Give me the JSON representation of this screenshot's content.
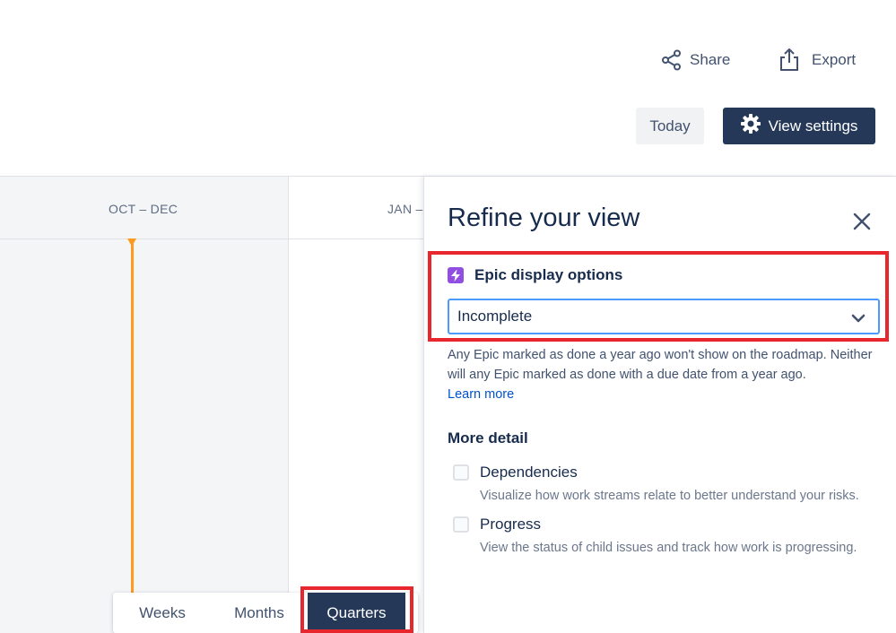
{
  "toolbar": {
    "share_label": "Share",
    "export_label": "Export",
    "today_label": "Today",
    "view_settings_label": "View settings"
  },
  "timeline": {
    "columns": [
      {
        "label": "OCT – DEC"
      },
      {
        "label": "JAN –"
      }
    ],
    "today_marker_color": "#ff991f",
    "zoom": {
      "options": [
        "Weeks",
        "Months",
        "Quarters"
      ],
      "selected": "Quarters"
    }
  },
  "panel": {
    "title": "Refine your view",
    "close_icon": "close-icon",
    "epic_display": {
      "icon": "epic-lightning-icon",
      "label": "Epic display options",
      "selected_value": "Incomplete",
      "help_text": "Any Epic marked as done a year ago won't show on the roadmap. Neither will any Epic marked as done with a due date from a year ago.",
      "learn_more": "Learn more"
    },
    "more_detail": {
      "title": "More detail",
      "options": [
        {
          "label": "Dependencies",
          "description": "Visualize how work streams relate to better understand your risks.",
          "checked": false
        },
        {
          "label": "Progress",
          "description": "View the status of child issues and track how work is progressing.",
          "checked": false
        }
      ]
    }
  },
  "colors": {
    "primary_dark": "#253858",
    "highlight_red": "#e8262d",
    "epic_purple": "#904ee2",
    "focus_blue": "#4c9aff",
    "link_blue": "#0052cc"
  }
}
